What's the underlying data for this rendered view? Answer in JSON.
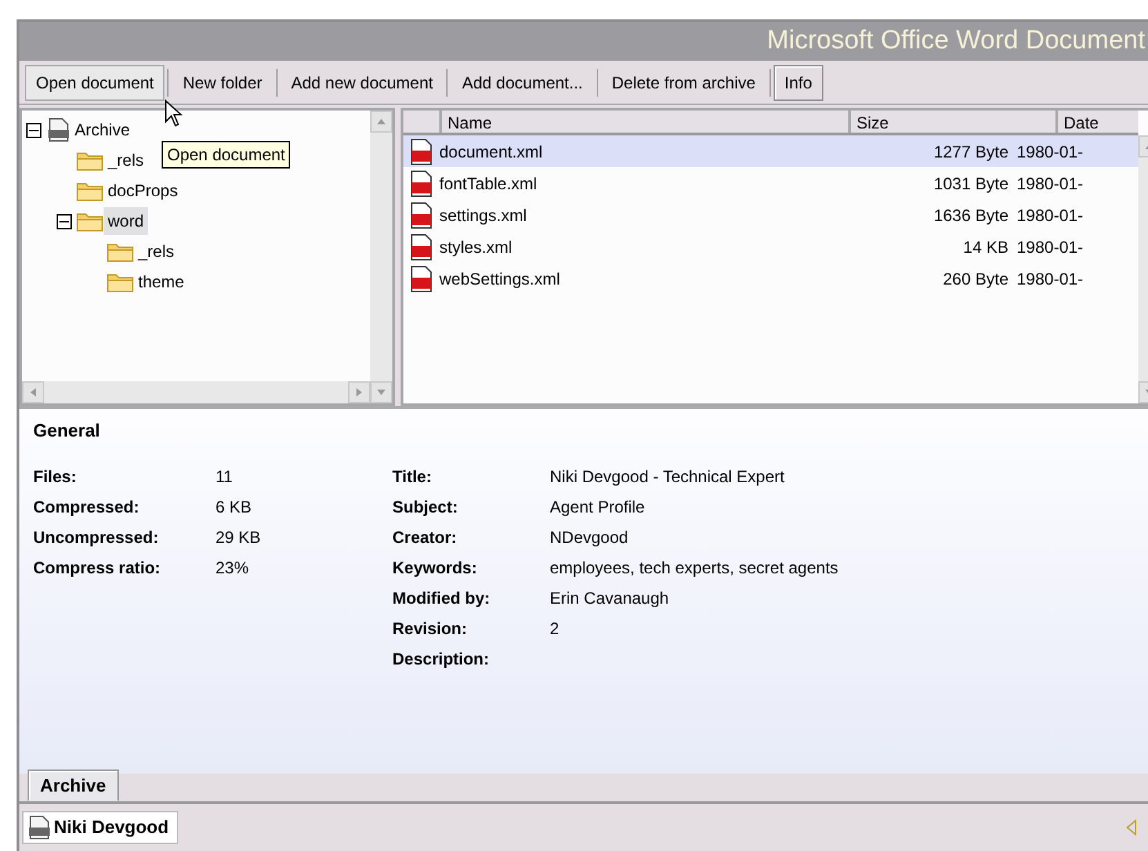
{
  "window": {
    "title": "Microsoft Office Word Document"
  },
  "toolbar": {
    "buttons": [
      {
        "label": "Open document",
        "hovered": true,
        "selected": false
      },
      {
        "label": "New folder",
        "hovered": false,
        "selected": false
      },
      {
        "label": "Add new document",
        "hovered": false,
        "selected": false
      },
      {
        "label": "Add document...",
        "hovered": false,
        "selected": false
      },
      {
        "label": "Delete from archive",
        "hovered": false,
        "selected": false
      },
      {
        "label": "Info",
        "hovered": false,
        "selected": true
      }
    ]
  },
  "tooltip": {
    "text": "Open document"
  },
  "tree": [
    {
      "label": "Archive",
      "kind": "archive",
      "expanded": true,
      "selected": false,
      "children": [
        {
          "label": "_rels",
          "kind": "folder",
          "selected": false
        },
        {
          "label": "docProps",
          "kind": "folder",
          "selected": false
        },
        {
          "label": "word",
          "kind": "folder",
          "expanded": true,
          "selected": true,
          "children": [
            {
              "label": "_rels",
              "kind": "folder",
              "selected": false
            },
            {
              "label": "theme",
              "kind": "folder",
              "selected": false
            }
          ]
        }
      ]
    }
  ],
  "file_list": {
    "columns": [
      "Name",
      "Size",
      "Date"
    ],
    "rows": [
      {
        "name": "document.xml",
        "size": "1277 Byte",
        "date": "1980-01-",
        "selected": true
      },
      {
        "name": "fontTable.xml",
        "size": "1031 Byte",
        "date": "1980-01-",
        "selected": false
      },
      {
        "name": "settings.xml",
        "size": "1636 Byte",
        "date": "1980-01-",
        "selected": false
      },
      {
        "name": "styles.xml",
        "size": "14 KB",
        "date": "1980-01-",
        "selected": false
      },
      {
        "name": "webSettings.xml",
        "size": "260 Byte",
        "date": "1980-01-",
        "selected": false
      }
    ]
  },
  "info": {
    "heading": "General",
    "left": [
      {
        "label": "Files:",
        "value": "11"
      },
      {
        "label": "Compressed:",
        "value": "6 KB"
      },
      {
        "label": "Uncompressed:",
        "value": "29 KB"
      },
      {
        "label": "Compress ratio:",
        "value": "23%"
      }
    ],
    "right": [
      {
        "label": "Title:",
        "value": "Niki Devgood - Technical Expert"
      },
      {
        "label": "Subject:",
        "value": "Agent Profile"
      },
      {
        "label": "Creator:",
        "value": "NDevgood"
      },
      {
        "label": "Keywords:",
        "value": "employees, tech experts, secret agents"
      },
      {
        "label": "Modified by:",
        "value": "Erin Cavanaugh"
      },
      {
        "label": "Revision:",
        "value": "2"
      },
      {
        "label": "Description:"
      }
    ]
  },
  "tabs": [
    {
      "label": "Archive",
      "selected": true
    }
  ],
  "status_bar": {
    "document": "Niki Devgood"
  }
}
